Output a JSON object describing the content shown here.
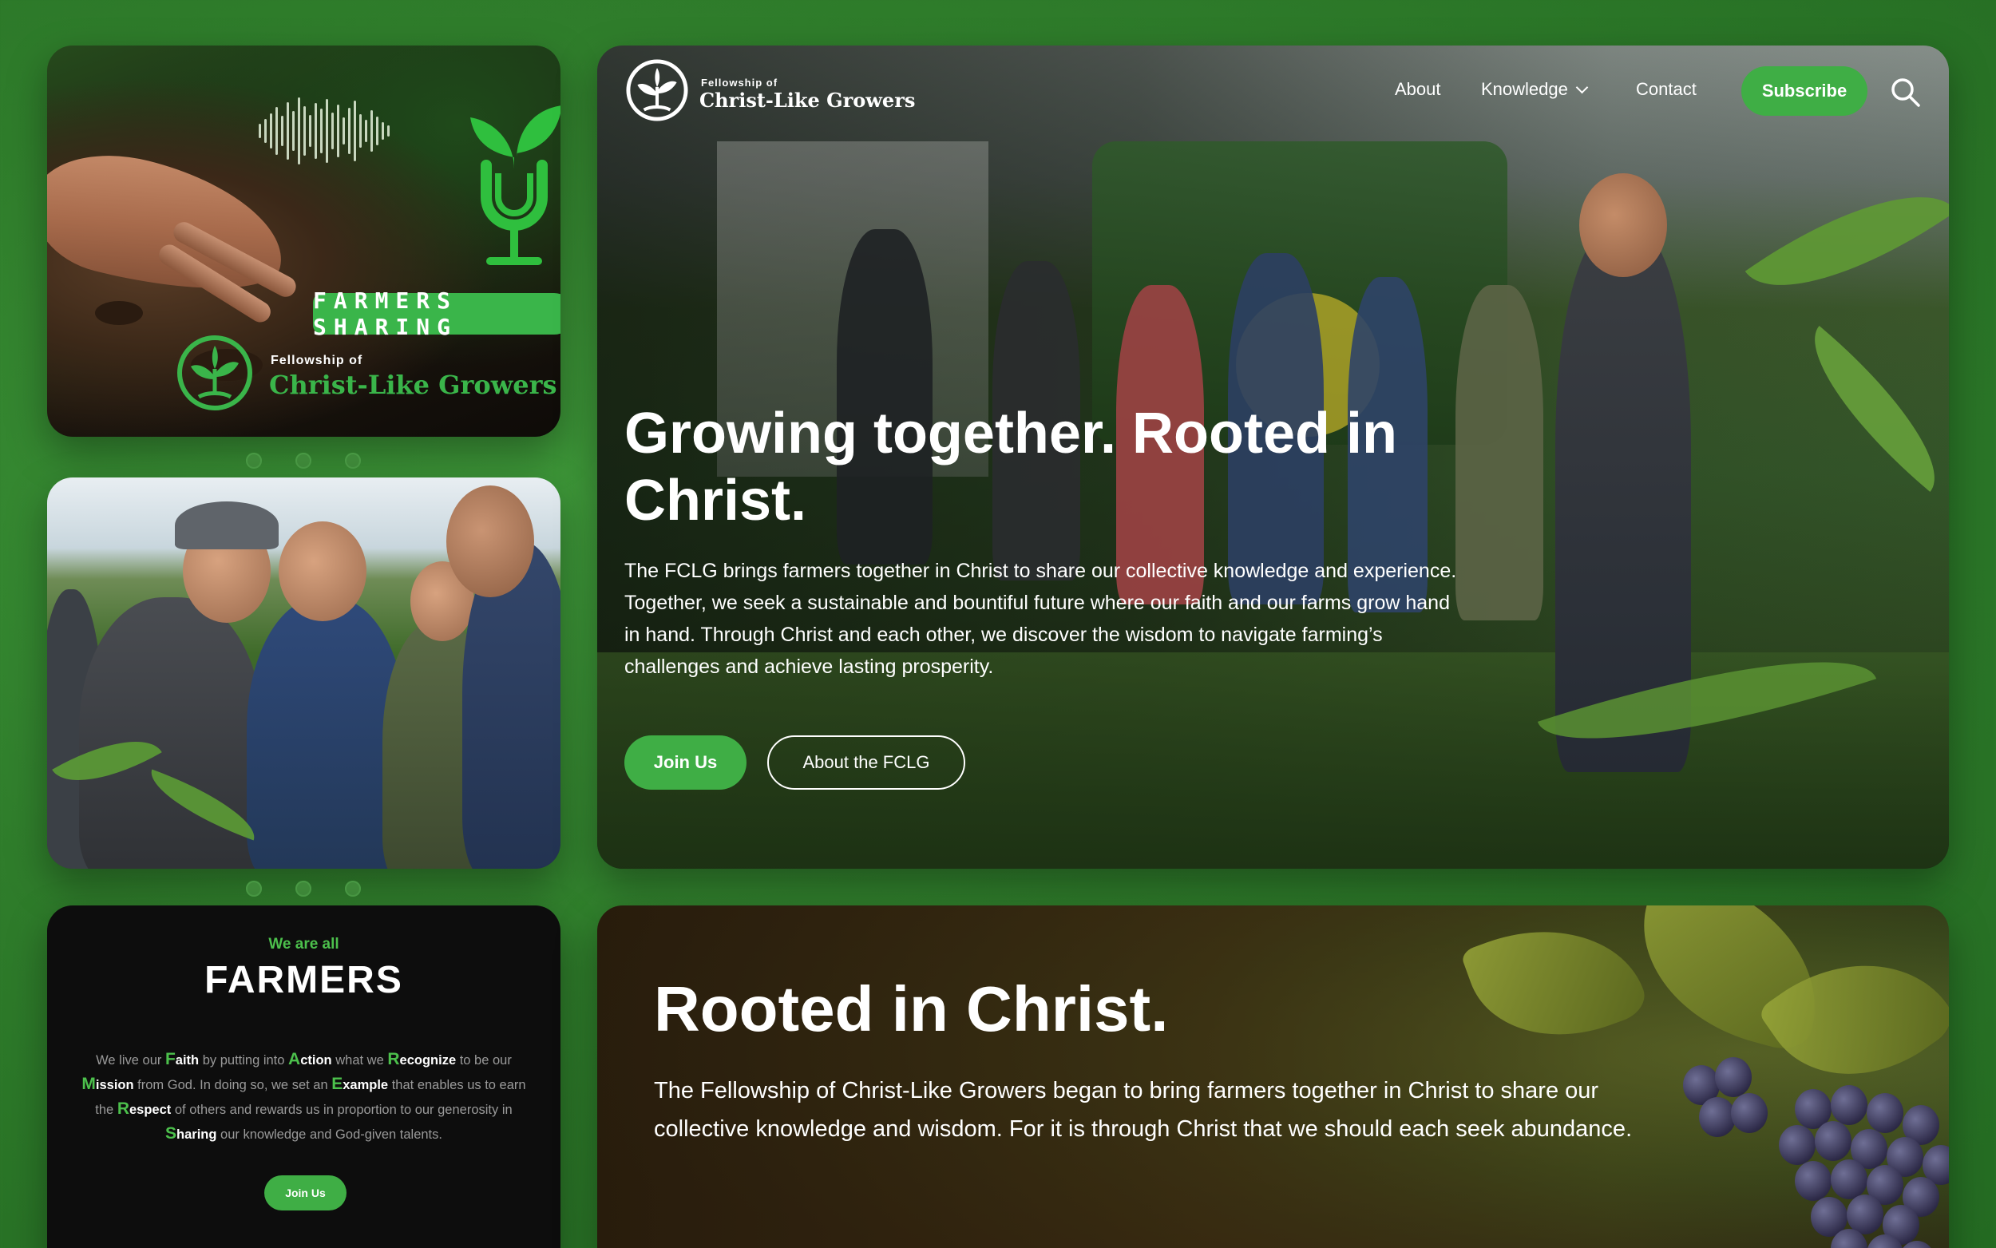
{
  "podcast": {
    "badge": "FARMERS SHARING",
    "org_small": "Fellowship of",
    "org_big": "Christ-Like Growers"
  },
  "farmers": {
    "eyebrow": "We are all",
    "title": "FARMERS",
    "body_parts": {
      "p1": "We live our ",
      "faith_cap": "F",
      "faith_rest": "aith",
      "p2": " by putting into ",
      "action_cap": "A",
      "action_rest": "ction",
      "p3": " what we ",
      "recognize_cap": "R",
      "recognize_rest": "ecognize",
      "p4": " to be our ",
      "mission_cap": "M",
      "mission_rest": "ission",
      "p5": " from God. In doing so, we set an ",
      "example_cap": "E",
      "example_rest": "xample",
      "p6": " that enables us to earn the ",
      "respect_cap": "R",
      "respect_rest": "espect",
      "p7": " of others and rewards us in proportion to our generosity in ",
      "sharing_cap": "S",
      "sharing_rest": "haring",
      "p8": " our knowledge and God-given talents."
    },
    "join_label": "Join Us"
  },
  "nav": {
    "logo_small": "Fellowship of",
    "logo_big": "Christ-Like Growers",
    "about": "About",
    "knowledge": "Knowledge",
    "contact": "Contact",
    "subscribe": "Subscribe"
  },
  "hero": {
    "title": "Growing together. Rooted in Christ.",
    "text": "The FCLG brings farmers together in Christ to share our collective knowledge and experience. Together, we seek a sustainable and bountiful future where our faith and our farms grow hand in hand. Through Christ and each other, we discover the wisdom to navigate farming’s challenges and achieve lasting prosperity.",
    "join_label": "Join Us",
    "about_label": "About the FCLG"
  },
  "rooted": {
    "title": "Rooted in Christ.",
    "text": "The Fellowship of Christ-Like Growers began to bring farmers together in Christ to share our collective knowledge and wisdom. For it is through Christ that we should each seek abundance."
  },
  "colors": {
    "brand_green": "#3fae45",
    "page_background": "#2f7d2b",
    "dark_card": "#0d0d0d"
  }
}
